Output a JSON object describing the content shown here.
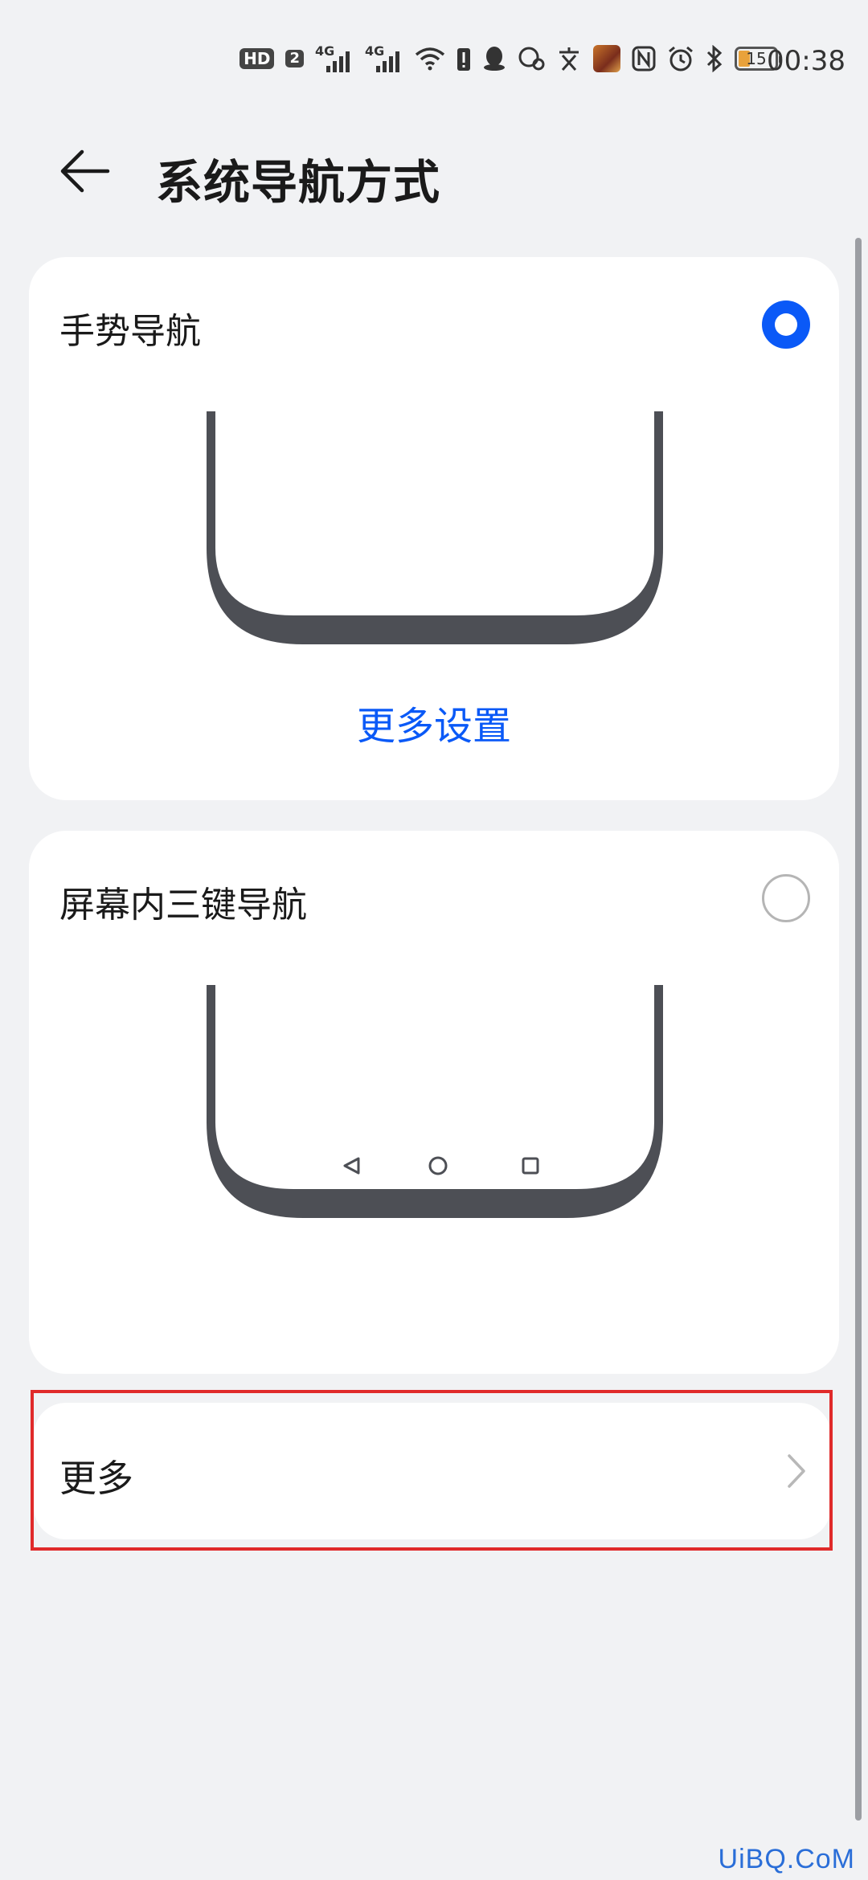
{
  "status_bar": {
    "hd_badge": "HD",
    "sim_badge": "2",
    "network_1": "4G",
    "network_2": "4G",
    "battery_level": "15",
    "time": "00:38",
    "icons": [
      "hd-icon",
      "signal-icon",
      "signal-icon",
      "wifi-icon",
      "alert-icon",
      "qq-icon",
      "chat-icon",
      "translate-icon",
      "game-avatar-icon",
      "nfc-icon",
      "alarm-icon",
      "bluetooth-icon",
      "battery-icon"
    ]
  },
  "header": {
    "back_icon": "back-arrow-icon",
    "title": "系统导航方式"
  },
  "options": [
    {
      "label": "手势导航",
      "selected": true,
      "link": "更多设置"
    },
    {
      "label": "屏幕内三键导航",
      "selected": false
    }
  ],
  "more": {
    "label": "更多",
    "icon": "chevron-right-icon"
  },
  "colors": {
    "accent": "#0a59f7",
    "background": "#f1f2f4",
    "card": "#ffffff",
    "highlight": "#e02a2a",
    "device": "#4d4f55"
  },
  "watermark": "UiBQ.CoM"
}
